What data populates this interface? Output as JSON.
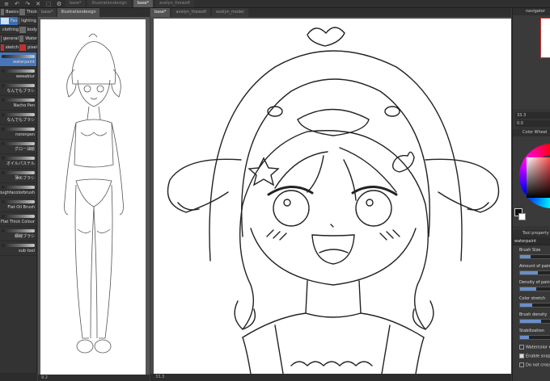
{
  "toolbar": {
    "icons": [
      "menu-icon",
      "undo-icon",
      "redo-icon",
      "clear-icon",
      "transform-icon",
      "settings-icon"
    ],
    "tabs": [
      {
        "label": "base*",
        "state": "dim"
      },
      {
        "label": "Illustrationdesign",
        "state": "dim"
      },
      {
        "label": "base*",
        "state": "active"
      },
      {
        "label": "avelyn_thewolf",
        "state": "dim"
      }
    ]
  },
  "brush_panel": {
    "categories": [
      {
        "label": "Basics",
        "color": "#6a6a6a"
      },
      {
        "label": "Thick",
        "color": "#6a6a6a"
      },
      {
        "label": "Fav",
        "color": "#3c6fb5"
      },
      {
        "label": "lighting",
        "color": "#6a6a6a"
      },
      {
        "label": "clothing",
        "color": "#6a6a6a"
      },
      {
        "label": "body",
        "color": "#6a6a6a"
      },
      {
        "label": "general",
        "color": "#6a6a6a"
      },
      {
        "label": "Water",
        "color": "#6a6a6a"
      },
      {
        "label": "sketch",
        "color": "#c03030"
      },
      {
        "label": "pixel",
        "color": "#c03030"
      }
    ],
    "brushes": [
      "waterpaint",
      "weeablur",
      "なんでもブラシ",
      "Nacho Pen",
      "なんでもブラシ",
      "noronpen",
      "グロー油絵",
      "オイルパステル",
      "薄めブラシ",
      "roughfacolorbrush",
      "Flat Oil Brush",
      "Flat Thick Colour",
      "細線ブラシ",
      "sub tool"
    ],
    "selected_index": 0
  },
  "reference": {
    "tabs": [
      "base*",
      "Illustrationdesign"
    ],
    "status": "9.2"
  },
  "main": {
    "tabs": [
      "base*",
      "avelyn_thewolf",
      "avelyn_model"
    ],
    "status": "33.3"
  },
  "navigator": {
    "title": "navigator",
    "zoom": "33.3",
    "angle": "0.0"
  },
  "color_panel": {
    "title": "Color Wheel",
    "main_color": "#111111",
    "sub_color": "#ffffff"
  },
  "tool_property": {
    "title": "Tool property",
    "brush_name": "waterpaint",
    "props": [
      {
        "label": "Brush Size",
        "fill": 0.35
      },
      {
        "label": "Amount of paint",
        "fill": 0.6
      },
      {
        "label": "Density of paint",
        "fill": 0.55
      },
      {
        "label": "Color stretch",
        "fill": 0.4
      },
      {
        "label": "Brush density",
        "fill": 0.7
      },
      {
        "label": "Stabilization",
        "fill": 0.3
      }
    ],
    "checks": [
      {
        "label": "Watercolor edge",
        "checked": false
      },
      {
        "label": "Enable snap",
        "checked": true
      },
      {
        "label": "Do not cross",
        "checked": false
      }
    ]
  }
}
